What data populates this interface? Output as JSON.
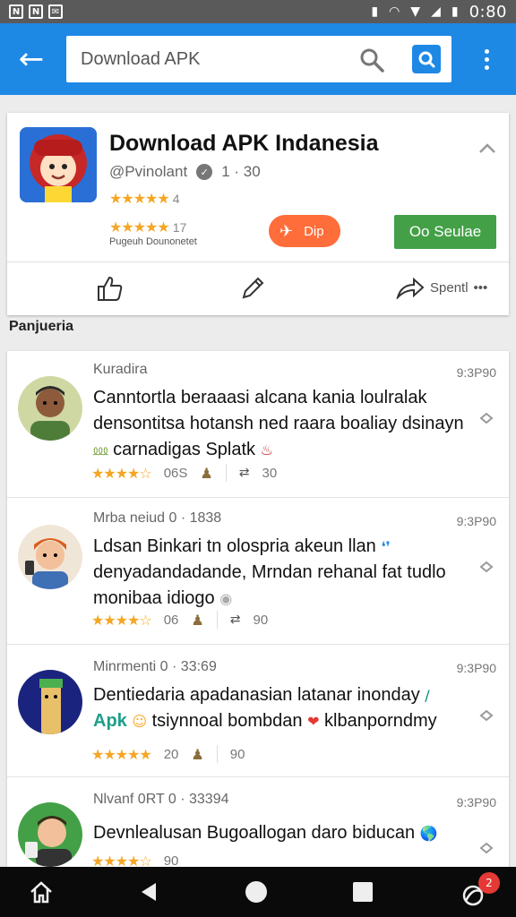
{
  "status_bar": {
    "time": "0:80"
  },
  "app_bar": {
    "search": {
      "value": "Download APK"
    }
  },
  "app": {
    "title": "Download APK Indanesia",
    "developer": "@Pvinolant",
    "developer_meta": "1 · 30",
    "rating_1": {
      "stars": "★★★★★",
      "value": "4"
    },
    "rating_2": {
      "stars": "★★★★★",
      "value": "17"
    },
    "rating_sub": "Pugeuh Dounonetet",
    "dp_button": "Dip",
    "install_button": "Oo Seulae",
    "share_label": "Spentl",
    "share_more": "•••"
  },
  "section_label": "Panjueria",
  "reviews": [
    {
      "name": "Kuradira",
      "time": "9:3P90",
      "text_1": "Canntortla beraaasi alcana kania loulralak densontitsa hotansh ned raara boaliay dsinayn",
      "text_2": "carnadigas Splatk",
      "stars": "★★★★☆",
      "count": "06S",
      "replies": "30"
    },
    {
      "name": "Mrba neiud 0 · 1838",
      "time": "9:3P90",
      "text_1": "Ldsan Binkari tn olospria akeun llan",
      "text_2": "denyadandadande, Mrndan rehanal fat tudlo monibaa idiogo",
      "stars": "★★★★☆",
      "count": "06",
      "replies": "90"
    },
    {
      "name": "Minrmenti 0 · 33:69",
      "time": "9:3P90",
      "text_1": "Dentiedaria apadanasian latanar inonday",
      "apk": "Apk",
      "text_2": "tsiynnoal bombdan",
      "text_3": "klbanporndmy",
      "stars": "★★★★★",
      "count": "20",
      "replies": "90"
    },
    {
      "name": "Nlvanf 0RT 0 · 33394",
      "time": "9:3P90",
      "text_1": "Devnlealusan Bugoallogan daro biducan",
      "stars": "★★★★☆",
      "count": "90"
    }
  ],
  "nav_bar": {
    "badge": "2"
  },
  "colors": {
    "primary": "#1e88e5",
    "install_green": "#43a047",
    "dp_orange": "#ff6d3a",
    "star": "#f5a623",
    "badge_red": "#e53935"
  }
}
